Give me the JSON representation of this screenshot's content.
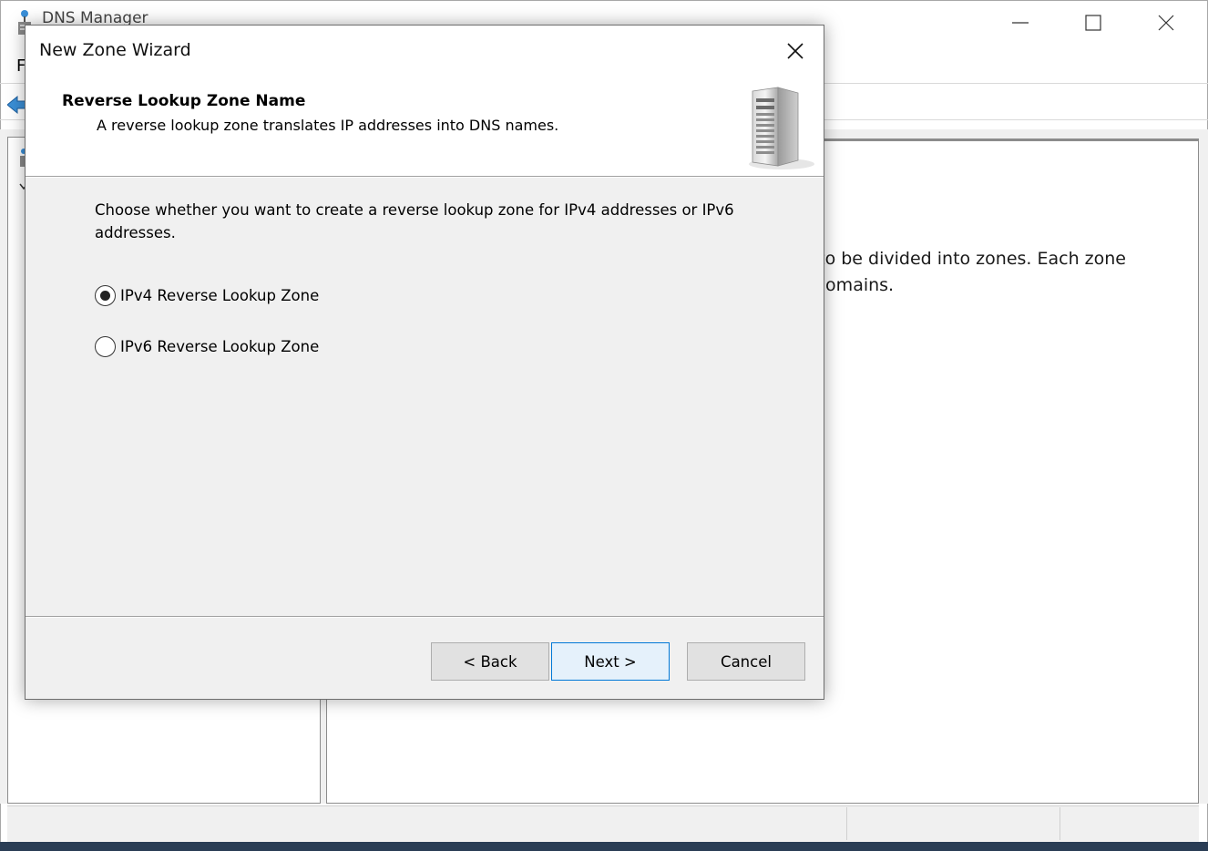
{
  "background_window": {
    "title": "DNS Manager",
    "menu_first": "F",
    "description_line1": "e to be divided into zones. Each zone",
    "description_line2": "domains."
  },
  "wizard": {
    "title": "New Zone Wizard",
    "header": {
      "title": "Reverse Lookup Zone Name",
      "subtitle": "A reverse lookup zone translates IP addresses into DNS names."
    },
    "instruction": "Choose whether you want to create a reverse lookup zone for IPv4 addresses or IPv6 addresses.",
    "options": [
      {
        "label": "IPv4 Reverse Lookup Zone",
        "selected": true
      },
      {
        "label": "IPv6 Reverse Lookup Zone",
        "selected": false
      }
    ],
    "buttons": {
      "back": "< Back",
      "next": "Next >",
      "cancel": "Cancel"
    }
  },
  "icons": {
    "app": "dns-manager-icon",
    "back": "back-arrow-icon",
    "header": "server-tower-icon",
    "close": "close-icon",
    "minimize": "minimize-icon",
    "maximize": "maximize-icon"
  },
  "colors": {
    "focus_border": "#0078d7",
    "default_button_fill": "#e5f1fb",
    "dialog_background": "#f0f0f0"
  }
}
